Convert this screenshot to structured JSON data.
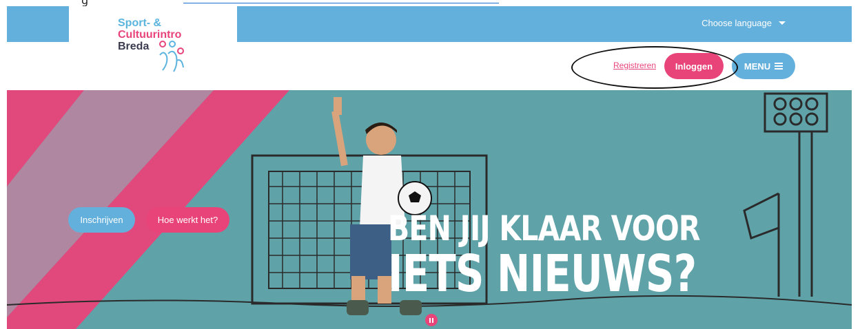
{
  "doc": {
    "prefix_text": "g"
  },
  "header": {
    "language_label": "Choose language",
    "logo": {
      "line1": "Sport- &",
      "line2": "Cultuurintro",
      "line3": "Breda"
    },
    "nav": {
      "register_label": "Registreren",
      "login_label": "Inloggen",
      "menu_label": "MENU"
    }
  },
  "hero": {
    "primary_button": "Inschrijven",
    "secondary_button": "Hoe werkt het?",
    "headline_line1": "BEN JIJ KLAAR VOOR",
    "headline_line2": "IETS NIEUWS?"
  },
  "icons": {
    "language_caret": "chevron-down-icon",
    "menu": "hamburger-icon",
    "pause": "pause-icon"
  },
  "colors": {
    "brand_blue": "#64b0dc",
    "brand_pink": "#e8447a",
    "hero_teal": "#5fa3a9"
  }
}
